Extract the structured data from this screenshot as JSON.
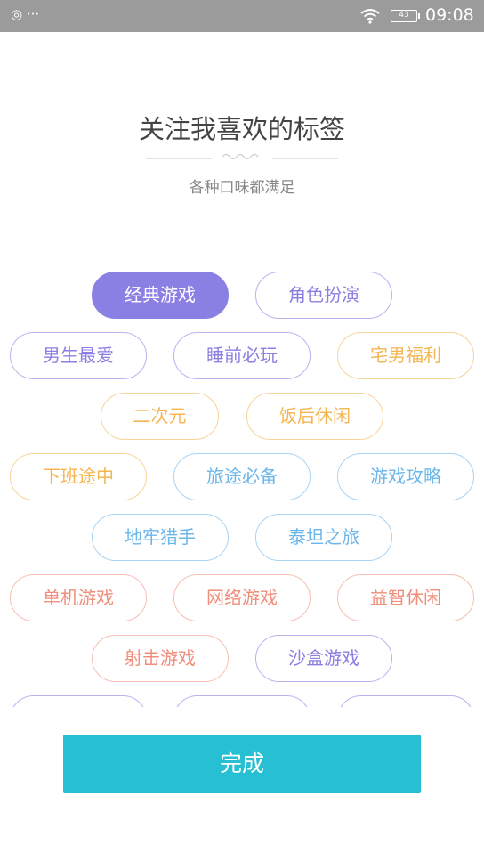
{
  "status_bar": {
    "left_icons": "◎ ···",
    "battery": "43",
    "time": "09:08"
  },
  "header": {
    "title": "关注我喜欢的标签",
    "subtitle": "各种口味都满足"
  },
  "tags": [
    {
      "label": "经典游戏",
      "color": "purple",
      "selected": true
    },
    {
      "label": "角色扮演",
      "color": "purple",
      "selected": false
    },
    {
      "label": "男生最爱",
      "color": "purple",
      "selected": false
    },
    {
      "label": "睡前必玩",
      "color": "purple",
      "selected": false
    },
    {
      "label": "宅男福利",
      "color": "orange",
      "selected": false
    },
    {
      "label": "二次元",
      "color": "orange",
      "selected": false
    },
    {
      "label": "饭后休闲",
      "color": "orange",
      "selected": false
    },
    {
      "label": "下班途中",
      "color": "orange",
      "selected": false
    },
    {
      "label": "旅途必备",
      "color": "blue",
      "selected": false
    },
    {
      "label": "游戏攻略",
      "color": "blue",
      "selected": false
    },
    {
      "label": "地牢猎手",
      "color": "blue",
      "selected": false
    },
    {
      "label": "泰坦之旅",
      "color": "blue",
      "selected": false
    },
    {
      "label": "单机游戏",
      "color": "salmon",
      "selected": false
    },
    {
      "label": "网络游戏",
      "color": "salmon",
      "selected": false
    },
    {
      "label": "益智休闲",
      "color": "salmon",
      "selected": false
    },
    {
      "label": "射击游戏",
      "color": "salmon",
      "selected": false
    },
    {
      "label": "沙盒游戏",
      "color": "purple",
      "selected": false
    },
    {
      "label": "",
      "color": "purple",
      "selected": false
    },
    {
      "label": "",
      "color": "purple",
      "selected": false
    },
    {
      "label": "",
      "color": "purple",
      "selected": false
    }
  ],
  "colors": {
    "accent_purple": "#8a7fe2",
    "orange": "#f5b550",
    "blue": "#6bb6ea",
    "salmon": "#f08e7c",
    "done_button": "#26bfd4"
  },
  "done_button": {
    "label": "完成"
  }
}
